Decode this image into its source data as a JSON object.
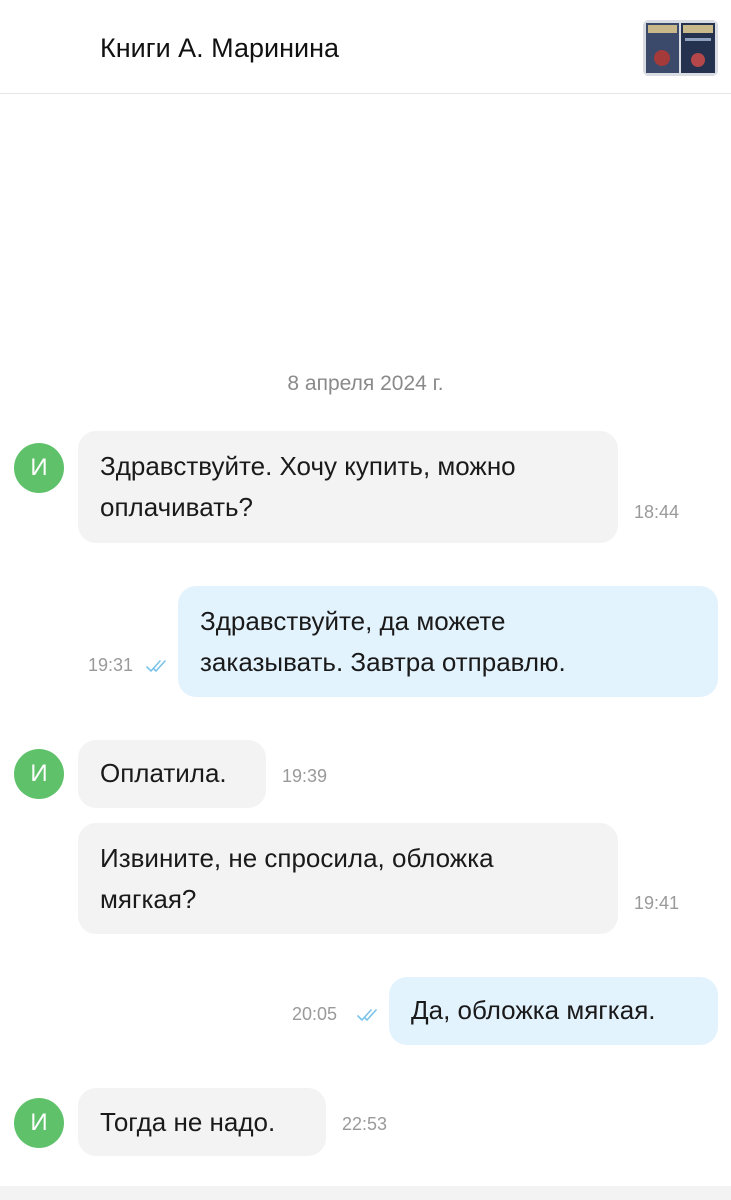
{
  "header": {
    "title": "Книги А. Маринина",
    "thumbnail_icon": "book-covers-thumbnail"
  },
  "chat": {
    "date": "8 апреля 2024 г.",
    "avatar_letter": "И",
    "messages": [
      {
        "side": "in",
        "lines": [
          "Здравствуйте. Хочу купить, можно",
          "оплачивать?"
        ],
        "time": "18:44"
      },
      {
        "side": "out",
        "lines": [
          "Здравствуйте, да можете",
          "заказывать. Завтра отправлю."
        ],
        "time": "19:31",
        "read": true
      },
      {
        "side": "in",
        "lines": [
          "Оплатила."
        ],
        "time": "19:39"
      },
      {
        "side": "in",
        "lines": [
          "Извините, не спросила, обложка",
          "мягкая?"
        ],
        "time": "19:41"
      },
      {
        "side": "out",
        "lines": [
          "Да, обложка мягкая."
        ],
        "time": "20:05",
        "read": true
      },
      {
        "side": "in",
        "lines": [
          "Тогда не надо."
        ],
        "time": "22:53"
      }
    ]
  },
  "colors": {
    "avatar": "#5fc26a",
    "incoming_bubble": "#f3f3f3",
    "outgoing_bubble": "#e3f3fd",
    "read_ticks": "#7cc3ea"
  }
}
